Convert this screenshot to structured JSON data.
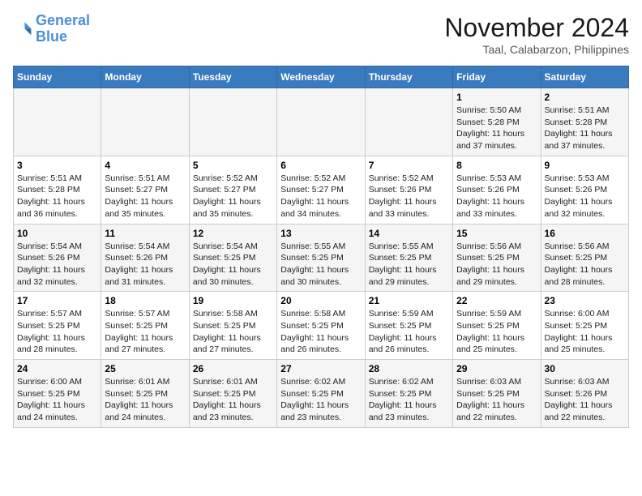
{
  "logo": {
    "line1": "General",
    "line2": "Blue"
  },
  "title": "November 2024",
  "location": "Taal, Calabarzon, Philippines",
  "weekdays": [
    "Sunday",
    "Monday",
    "Tuesday",
    "Wednesday",
    "Thursday",
    "Friday",
    "Saturday"
  ],
  "weeks": [
    [
      {
        "day": "",
        "sunrise": "",
        "sunset": "",
        "daylight": ""
      },
      {
        "day": "",
        "sunrise": "",
        "sunset": "",
        "daylight": ""
      },
      {
        "day": "",
        "sunrise": "",
        "sunset": "",
        "daylight": ""
      },
      {
        "day": "",
        "sunrise": "",
        "sunset": "",
        "daylight": ""
      },
      {
        "day": "",
        "sunrise": "",
        "sunset": "",
        "daylight": ""
      },
      {
        "day": "1",
        "sunrise": "Sunrise: 5:50 AM",
        "sunset": "Sunset: 5:28 PM",
        "daylight": "Daylight: 11 hours and 37 minutes."
      },
      {
        "day": "2",
        "sunrise": "Sunrise: 5:51 AM",
        "sunset": "Sunset: 5:28 PM",
        "daylight": "Daylight: 11 hours and 37 minutes."
      }
    ],
    [
      {
        "day": "3",
        "sunrise": "Sunrise: 5:51 AM",
        "sunset": "Sunset: 5:28 PM",
        "daylight": "Daylight: 11 hours and 36 minutes."
      },
      {
        "day": "4",
        "sunrise": "Sunrise: 5:51 AM",
        "sunset": "Sunset: 5:27 PM",
        "daylight": "Daylight: 11 hours and 35 minutes."
      },
      {
        "day": "5",
        "sunrise": "Sunrise: 5:52 AM",
        "sunset": "Sunset: 5:27 PM",
        "daylight": "Daylight: 11 hours and 35 minutes."
      },
      {
        "day": "6",
        "sunrise": "Sunrise: 5:52 AM",
        "sunset": "Sunset: 5:27 PM",
        "daylight": "Daylight: 11 hours and 34 minutes."
      },
      {
        "day": "7",
        "sunrise": "Sunrise: 5:52 AM",
        "sunset": "Sunset: 5:26 PM",
        "daylight": "Daylight: 11 hours and 33 minutes."
      },
      {
        "day": "8",
        "sunrise": "Sunrise: 5:53 AM",
        "sunset": "Sunset: 5:26 PM",
        "daylight": "Daylight: 11 hours and 33 minutes."
      },
      {
        "day": "9",
        "sunrise": "Sunrise: 5:53 AM",
        "sunset": "Sunset: 5:26 PM",
        "daylight": "Daylight: 11 hours and 32 minutes."
      }
    ],
    [
      {
        "day": "10",
        "sunrise": "Sunrise: 5:54 AM",
        "sunset": "Sunset: 5:26 PM",
        "daylight": "Daylight: 11 hours and 32 minutes."
      },
      {
        "day": "11",
        "sunrise": "Sunrise: 5:54 AM",
        "sunset": "Sunset: 5:26 PM",
        "daylight": "Daylight: 11 hours and 31 minutes."
      },
      {
        "day": "12",
        "sunrise": "Sunrise: 5:54 AM",
        "sunset": "Sunset: 5:25 PM",
        "daylight": "Daylight: 11 hours and 30 minutes."
      },
      {
        "day": "13",
        "sunrise": "Sunrise: 5:55 AM",
        "sunset": "Sunset: 5:25 PM",
        "daylight": "Daylight: 11 hours and 30 minutes."
      },
      {
        "day": "14",
        "sunrise": "Sunrise: 5:55 AM",
        "sunset": "Sunset: 5:25 PM",
        "daylight": "Daylight: 11 hours and 29 minutes."
      },
      {
        "day": "15",
        "sunrise": "Sunrise: 5:56 AM",
        "sunset": "Sunset: 5:25 PM",
        "daylight": "Daylight: 11 hours and 29 minutes."
      },
      {
        "day": "16",
        "sunrise": "Sunrise: 5:56 AM",
        "sunset": "Sunset: 5:25 PM",
        "daylight": "Daylight: 11 hours and 28 minutes."
      }
    ],
    [
      {
        "day": "17",
        "sunrise": "Sunrise: 5:57 AM",
        "sunset": "Sunset: 5:25 PM",
        "daylight": "Daylight: 11 hours and 28 minutes."
      },
      {
        "day": "18",
        "sunrise": "Sunrise: 5:57 AM",
        "sunset": "Sunset: 5:25 PM",
        "daylight": "Daylight: 11 hours and 27 minutes."
      },
      {
        "day": "19",
        "sunrise": "Sunrise: 5:58 AM",
        "sunset": "Sunset: 5:25 PM",
        "daylight": "Daylight: 11 hours and 27 minutes."
      },
      {
        "day": "20",
        "sunrise": "Sunrise: 5:58 AM",
        "sunset": "Sunset: 5:25 PM",
        "daylight": "Daylight: 11 hours and 26 minutes."
      },
      {
        "day": "21",
        "sunrise": "Sunrise: 5:59 AM",
        "sunset": "Sunset: 5:25 PM",
        "daylight": "Daylight: 11 hours and 26 minutes."
      },
      {
        "day": "22",
        "sunrise": "Sunrise: 5:59 AM",
        "sunset": "Sunset: 5:25 PM",
        "daylight": "Daylight: 11 hours and 25 minutes."
      },
      {
        "day": "23",
        "sunrise": "Sunrise: 6:00 AM",
        "sunset": "Sunset: 5:25 PM",
        "daylight": "Daylight: 11 hours and 25 minutes."
      }
    ],
    [
      {
        "day": "24",
        "sunrise": "Sunrise: 6:00 AM",
        "sunset": "Sunset: 5:25 PM",
        "daylight": "Daylight: 11 hours and 24 minutes."
      },
      {
        "day": "25",
        "sunrise": "Sunrise: 6:01 AM",
        "sunset": "Sunset: 5:25 PM",
        "daylight": "Daylight: 11 hours and 24 minutes."
      },
      {
        "day": "26",
        "sunrise": "Sunrise: 6:01 AM",
        "sunset": "Sunset: 5:25 PM",
        "daylight": "Daylight: 11 hours and 23 minutes."
      },
      {
        "day": "27",
        "sunrise": "Sunrise: 6:02 AM",
        "sunset": "Sunset: 5:25 PM",
        "daylight": "Daylight: 11 hours and 23 minutes."
      },
      {
        "day": "28",
        "sunrise": "Sunrise: 6:02 AM",
        "sunset": "Sunset: 5:25 PM",
        "daylight": "Daylight: 11 hours and 23 minutes."
      },
      {
        "day": "29",
        "sunrise": "Sunrise: 6:03 AM",
        "sunset": "Sunset: 5:25 PM",
        "daylight": "Daylight: 11 hours and 22 minutes."
      },
      {
        "day": "30",
        "sunrise": "Sunrise: 6:03 AM",
        "sunset": "Sunset: 5:26 PM",
        "daylight": "Daylight: 11 hours and 22 minutes."
      }
    ]
  ]
}
